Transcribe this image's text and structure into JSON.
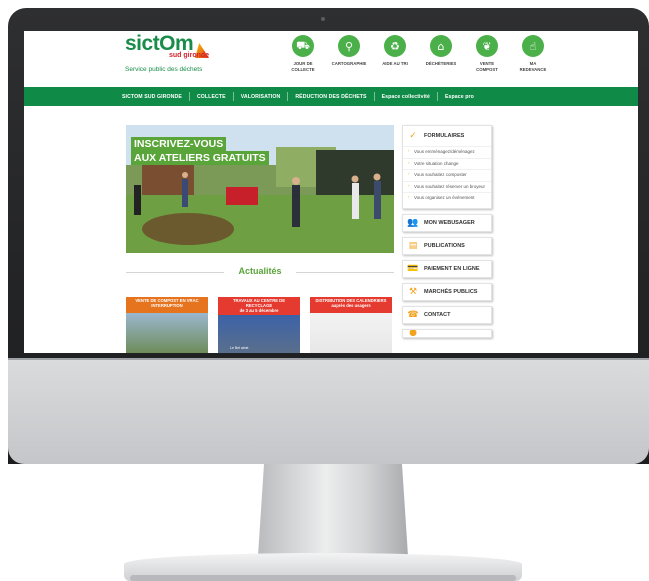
{
  "colors": {
    "brand_green": "#0f8a47",
    "accent_green": "#4cb04a",
    "accent_orange": "#f2a21b"
  },
  "logo": {
    "word": "sictOm",
    "sub": "sud gironde",
    "tagline": "Service public des déchets"
  },
  "quick_links": [
    {
      "icon": "truck-icon",
      "glyph": "⛟",
      "label": "JOUR DE\nCOLLECTE"
    },
    {
      "icon": "map-pin-icon",
      "glyph": "⚲",
      "label": "CARTOGRAPHIE"
    },
    {
      "icon": "recycle-icon",
      "glyph": "♻",
      "label": "AIDE AU TRI"
    },
    {
      "icon": "house-icon",
      "glyph": "⌂",
      "label": "DÉCHÈTERIES"
    },
    {
      "icon": "leaf-icon",
      "glyph": "❦",
      "label": "VENTE\nCOMPOST"
    },
    {
      "icon": "hand-coin-icon",
      "glyph": "☝",
      "label": "MA\nREDEVANCE"
    }
  ],
  "nav": {
    "items": [
      "SICTOM SUD GIRONDE",
      "COLLECTE",
      "VALORISATION",
      "RÉDUCTION DES DÉCHETS",
      "Espace collectivité",
      "Espace pro"
    ]
  },
  "hero": {
    "line1": "INSCRIVEZ-VOUS",
    "line2": "AUX ATELIERS GRATUITS"
  },
  "news": {
    "title": "Actualités",
    "cards": [
      {
        "caption": "VENTE DE COMPOST EN VRAC\nINTERRUPTION",
        "color": "#e6731e"
      },
      {
        "caption": "TRAVAUX AU CENTRE DE RECYCLAGE\nde 3 au 5 décembre",
        "color": "#e53a2f",
        "tag": "Le Bel aimé"
      },
      {
        "caption": "DISTRIBUTION DES CALENDRIERS\nauprès des usagers",
        "color": "#e53a2f"
      }
    ]
  },
  "sidebar": {
    "forms_title": "FORMULAIRES",
    "form_links": [
      "Vous emménagez/déménagez",
      "Votre situation change",
      "Vous souhaitez composter",
      "Vous souhaitez réserver un broyeur",
      "Vous organisez un événement"
    ],
    "buttons": [
      {
        "icon": "users-icon",
        "glyph": "👥",
        "label": "MON WEBUSAGER"
      },
      {
        "icon": "document-icon",
        "glyph": "▤",
        "label": "PUBLICATIONS"
      },
      {
        "icon": "payment-icon",
        "glyph": "💳",
        "label": "PAIEMENT EN LIGNE"
      },
      {
        "icon": "hammer-icon",
        "glyph": "⚒",
        "label": "MARCHÉS PUBLICS"
      },
      {
        "icon": "phone-icon",
        "glyph": "☎",
        "label": "CONTACT"
      }
    ]
  }
}
